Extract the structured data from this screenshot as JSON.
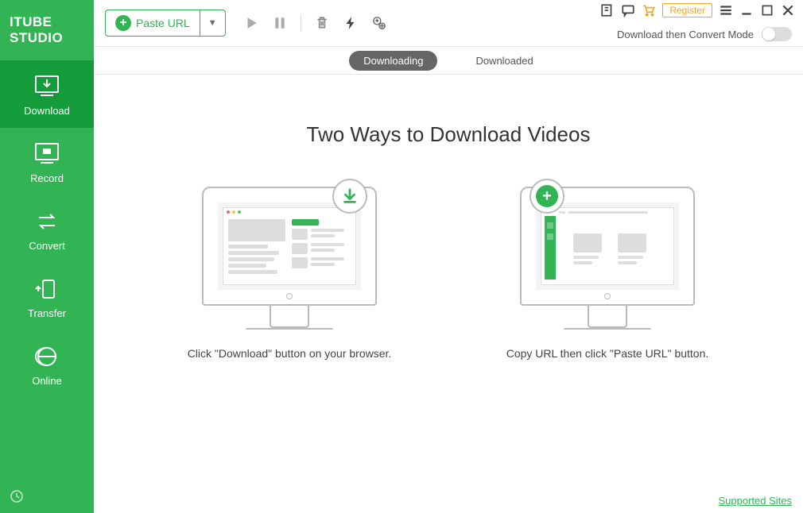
{
  "app_name": "ITUBE STUDIO",
  "sidebar": {
    "items": [
      {
        "label": "Download"
      },
      {
        "label": "Record"
      },
      {
        "label": "Convert"
      },
      {
        "label": "Transfer"
      },
      {
        "label": "Online"
      }
    ]
  },
  "toolbar": {
    "paste_url_label": "Paste URL"
  },
  "window": {
    "register_label": "Register",
    "convert_mode_label": "Download then Convert Mode"
  },
  "tabs": {
    "downloading": "Downloading",
    "downloaded": "Downloaded"
  },
  "content": {
    "headline": "Two Ways to Download Videos",
    "way1_desc": "Click \"Download\" button on your browser.",
    "way2_desc": "Copy URL then click \"Paste URL\" button."
  },
  "footer": {
    "supported_sites": "Supported Sites"
  }
}
